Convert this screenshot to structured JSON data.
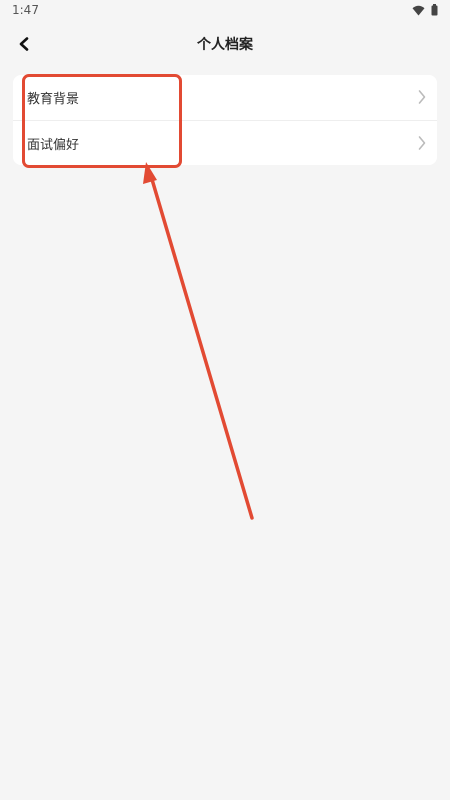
{
  "status_bar": {
    "time": "1:47",
    "icons": [
      "wifi-icon",
      "battery-icon"
    ]
  },
  "header": {
    "title": "个人档案",
    "back_icon": "back-arrow-icon"
  },
  "list": {
    "items": [
      {
        "label": "教育背景",
        "icon": "chevron-right-icon"
      },
      {
        "label": "面试偏好",
        "icon": "chevron-right-icon"
      }
    ]
  },
  "colors": {
    "background": "#f5f5f5",
    "card": "#ffffff",
    "annotation": "#e24a33",
    "chevron": "#bbbbbb"
  }
}
